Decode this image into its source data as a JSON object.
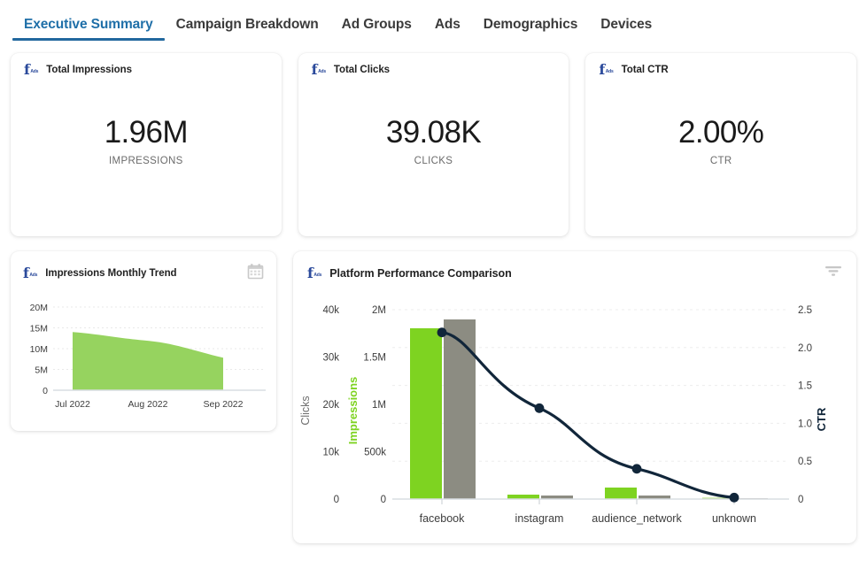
{
  "tabs": [
    {
      "label": "Executive Summary",
      "active": true
    },
    {
      "label": "Campaign Breakdown",
      "active": false
    },
    {
      "label": "Ad Groups",
      "active": false
    },
    {
      "label": "Ads",
      "active": false
    },
    {
      "label": "Demographics",
      "active": false
    },
    {
      "label": "Devices",
      "active": false
    }
  ],
  "brand_icon": {
    "letter": "f",
    "sub": "Ads",
    "color": "#2b4a9b",
    "name": "facebook-ads-icon"
  },
  "kpis": [
    {
      "title": "Total Impressions",
      "value": "1.96M",
      "label": "IMPRESSIONS"
    },
    {
      "title": "Total Clicks",
      "value": "39.08K",
      "label": "CLICKS"
    },
    {
      "title": "Total CTR",
      "value": "2.00%",
      "label": "CTR"
    }
  ],
  "trend_card": {
    "title": "Impressions Monthly Trend",
    "icon": "calendar-icon"
  },
  "platform_card": {
    "title": "Platform Performance Comparison",
    "icon": "filter-icon"
  },
  "colors": {
    "accent_blue": "#22689e",
    "clicks_green": "#7ed321",
    "impressions_gray": "#8c8c82",
    "ctr_line": "#11263a",
    "area_green": "#96d35f",
    "axis_text": "#3d3d3d",
    "grid": "#e8e8e8"
  },
  "chart_data": [
    {
      "type": "area",
      "title": "Impressions Monthly Trend",
      "categories": [
        "Jul 2022",
        "Aug 2022",
        "Sep 2022"
      ],
      "x": [
        "Jul 2022",
        "Aug 2022",
        "Sep 2022"
      ],
      "values": [
        14000000,
        12000000,
        7800000
      ],
      "series": [
        {
          "name": "Impressions",
          "values": [
            14000000,
            12000000,
            7800000
          ]
        }
      ],
      "xlabel": "",
      "ylabel": "",
      "ytick_labels": [
        "0",
        "5M",
        "10M",
        "15M",
        "20M"
      ],
      "ytick_values": [
        0,
        5000000,
        10000000,
        15000000,
        20000000
      ],
      "ylim": [
        0,
        20000000
      ],
      "grid": true,
      "legend": "none",
      "fill_color": "#96d35f"
    },
    {
      "type": "bar",
      "title": "Platform Performance Comparison",
      "categories": [
        "facebook",
        "instagram",
        "audience_network",
        "unknown"
      ],
      "series": [
        {
          "name": "Clicks",
          "type": "bar",
          "axis": "left",
          "color": "#7ed321",
          "values": [
            36000,
            900,
            2400,
            60
          ]
        },
        {
          "name": "Impressions",
          "type": "bar",
          "axis": "left2",
          "color": "#8c8c82",
          "values": [
            1900000,
            42000,
            41000,
            3000
          ]
        },
        {
          "name": "CTR",
          "type": "line",
          "axis": "right",
          "color": "#11263a",
          "values": [
            2.2,
            1.2,
            0.4,
            0.02
          ]
        }
      ],
      "axes": {
        "left": {
          "label": "Clicks",
          "ticks": [
            0,
            10000,
            20000,
            30000,
            40000
          ],
          "tick_labels": [
            "0",
            "10k",
            "20k",
            "30k",
            "40k"
          ],
          "lim": [
            0,
            40000
          ],
          "color": "#3d3d3d"
        },
        "left2": {
          "label": "Impressions",
          "ticks": [
            0,
            500000,
            1000000,
            1500000,
            2000000
          ],
          "tick_labels": [
            "0",
            "500k",
            "1M",
            "1.5M",
            "2M"
          ],
          "lim": [
            0,
            2000000
          ],
          "color": "#7ed321"
        },
        "right": {
          "label": "CTR",
          "ticks": [
            0,
            0.5,
            1.0,
            1.5,
            2.0,
            2.5
          ],
          "tick_labels": [
            "0",
            "0.5",
            "1.0",
            "1.5",
            "2.0",
            "2.5"
          ],
          "lim": [
            0,
            2.5
          ],
          "color": "#11263a"
        }
      },
      "xlabel": "",
      "grid": true,
      "legend": "none"
    }
  ]
}
